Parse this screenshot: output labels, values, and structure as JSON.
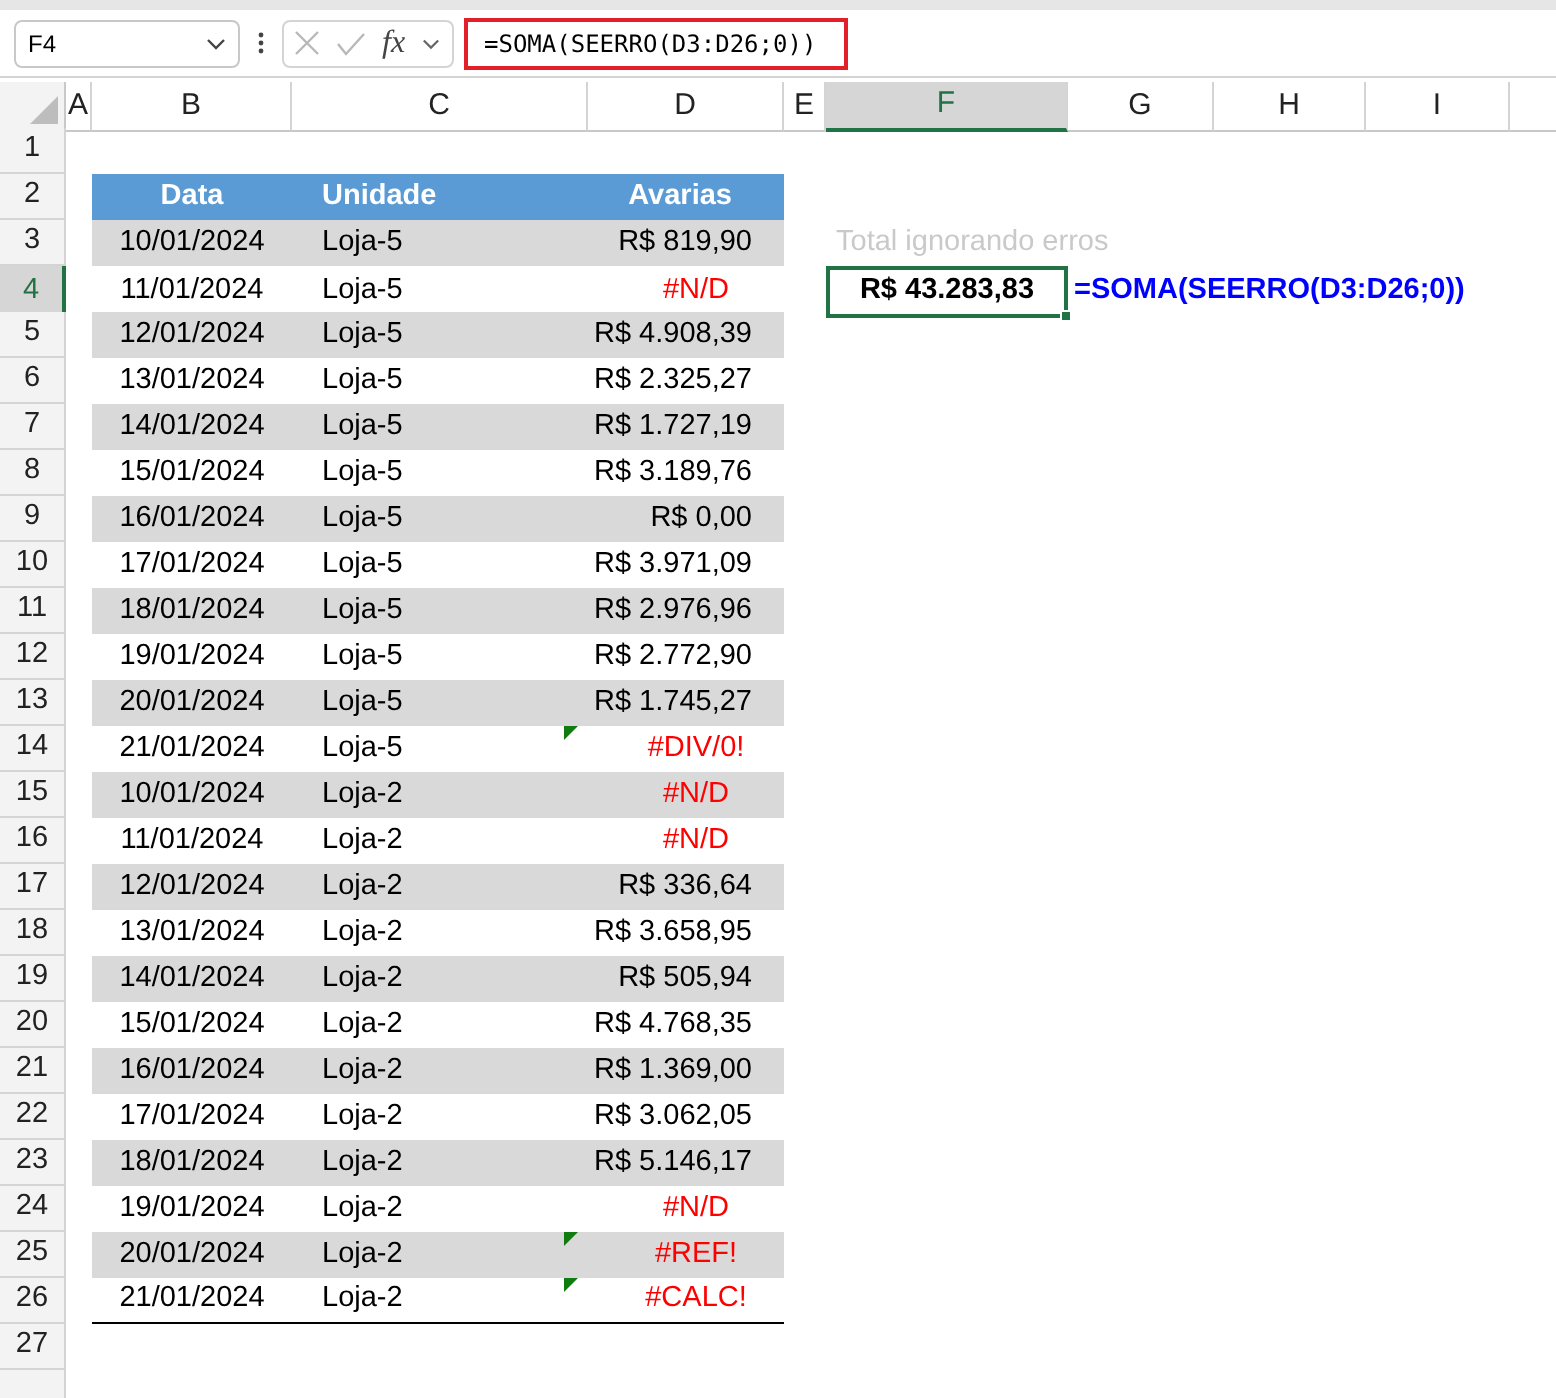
{
  "name_box": {
    "value": "F4"
  },
  "formula_bar": {
    "function_label": "fx",
    "formula": "=SOMA(SEERRO(D3:D26;0))"
  },
  "columns": [
    {
      "label": "A",
      "selected": false
    },
    {
      "label": "B",
      "selected": false
    },
    {
      "label": "C",
      "selected": false
    },
    {
      "label": "D",
      "selected": false
    },
    {
      "label": "E",
      "selected": false
    },
    {
      "label": "F",
      "selected": true
    },
    {
      "label": "G",
      "selected": false
    },
    {
      "label": "H",
      "selected": false
    },
    {
      "label": "I",
      "selected": false
    }
  ],
  "row_headers": [
    {
      "label": "1",
      "selected": false
    },
    {
      "label": "2",
      "selected": false
    },
    {
      "label": "3",
      "selected": false
    },
    {
      "label": "4",
      "selected": true
    },
    {
      "label": "5",
      "selected": false
    },
    {
      "label": "6",
      "selected": false
    },
    {
      "label": "7",
      "selected": false
    },
    {
      "label": "8",
      "selected": false
    },
    {
      "label": "9",
      "selected": false
    },
    {
      "label": "10",
      "selected": false
    },
    {
      "label": "11",
      "selected": false
    },
    {
      "label": "12",
      "selected": false
    },
    {
      "label": "13",
      "selected": false
    },
    {
      "label": "14",
      "selected": false
    },
    {
      "label": "15",
      "selected": false
    },
    {
      "label": "16",
      "selected": false
    },
    {
      "label": "17",
      "selected": false
    },
    {
      "label": "18",
      "selected": false
    },
    {
      "label": "19",
      "selected": false
    },
    {
      "label": "20",
      "selected": false
    },
    {
      "label": "21",
      "selected": false
    },
    {
      "label": "22",
      "selected": false
    },
    {
      "label": "23",
      "selected": false
    },
    {
      "label": "24",
      "selected": false
    },
    {
      "label": "25",
      "selected": false
    },
    {
      "label": "26",
      "selected": false
    },
    {
      "label": "27",
      "selected": false
    }
  ],
  "table": {
    "headers": [
      "Data",
      "Unidade",
      "Avarias"
    ],
    "rows": [
      {
        "date": "10/01/2024",
        "unit": "Loja-5",
        "amount": "R$ 819,90",
        "kind": "value",
        "flagged": false
      },
      {
        "date": "11/01/2024",
        "unit": "Loja-5",
        "amount": "#N/D",
        "kind": "error",
        "flagged": false
      },
      {
        "date": "12/01/2024",
        "unit": "Loja-5",
        "amount": "R$ 4.908,39",
        "kind": "value",
        "flagged": false
      },
      {
        "date": "13/01/2024",
        "unit": "Loja-5",
        "amount": "R$ 2.325,27",
        "kind": "value",
        "flagged": false
      },
      {
        "date": "14/01/2024",
        "unit": "Loja-5",
        "amount": "R$ 1.727,19",
        "kind": "value",
        "flagged": false
      },
      {
        "date": "15/01/2024",
        "unit": "Loja-5",
        "amount": "R$ 3.189,76",
        "kind": "value",
        "flagged": false
      },
      {
        "date": "16/01/2024",
        "unit": "Loja-5",
        "amount": "R$ 0,00",
        "kind": "value",
        "flagged": false
      },
      {
        "date": "17/01/2024",
        "unit": "Loja-5",
        "amount": "R$ 3.971,09",
        "kind": "value",
        "flagged": false
      },
      {
        "date": "18/01/2024",
        "unit": "Loja-5",
        "amount": "R$ 2.976,96",
        "kind": "value",
        "flagged": false
      },
      {
        "date": "19/01/2024",
        "unit": "Loja-5",
        "amount": "R$ 2.772,90",
        "kind": "value",
        "flagged": false
      },
      {
        "date": "20/01/2024",
        "unit": "Loja-5",
        "amount": "R$ 1.745,27",
        "kind": "value",
        "flagged": false
      },
      {
        "date": "21/01/2024",
        "unit": "Loja-5",
        "amount": "#DIV/0!",
        "kind": "error",
        "flagged": true
      },
      {
        "date": "10/01/2024",
        "unit": "Loja-2",
        "amount": "#N/D",
        "kind": "error",
        "flagged": false
      },
      {
        "date": "11/01/2024",
        "unit": "Loja-2",
        "amount": "#N/D",
        "kind": "error",
        "flagged": false
      },
      {
        "date": "12/01/2024",
        "unit": "Loja-2",
        "amount": "R$ 336,64",
        "kind": "value",
        "flagged": false
      },
      {
        "date": "13/01/2024",
        "unit": "Loja-2",
        "amount": "R$ 3.658,95",
        "kind": "value",
        "flagged": false
      },
      {
        "date": "14/01/2024",
        "unit": "Loja-2",
        "amount": "R$ 505,94",
        "kind": "value",
        "flagged": false
      },
      {
        "date": "15/01/2024",
        "unit": "Loja-2",
        "amount": "R$ 4.768,35",
        "kind": "value",
        "flagged": false
      },
      {
        "date": "16/01/2024",
        "unit": "Loja-2",
        "amount": "R$ 1.369,00",
        "kind": "value",
        "flagged": false
      },
      {
        "date": "17/01/2024",
        "unit": "Loja-2",
        "amount": "R$ 3.062,05",
        "kind": "value",
        "flagged": false
      },
      {
        "date": "18/01/2024",
        "unit": "Loja-2",
        "amount": "R$ 5.146,17",
        "kind": "value",
        "flagged": false
      },
      {
        "date": "19/01/2024",
        "unit": "Loja-2",
        "amount": "#N/D",
        "kind": "error",
        "flagged": false
      },
      {
        "date": "20/01/2024",
        "unit": "Loja-2",
        "amount": "#REF!",
        "kind": "error",
        "flagged": true
      },
      {
        "date": "21/01/2024",
        "unit": "Loja-2",
        "amount": "#CALC!",
        "kind": "error",
        "flagged": true
      }
    ]
  },
  "summary": {
    "label": "Total ignorando erros",
    "value": "R$ 43.283,83",
    "formula": "=SOMA(SEERRO(D3:D26;0))"
  }
}
